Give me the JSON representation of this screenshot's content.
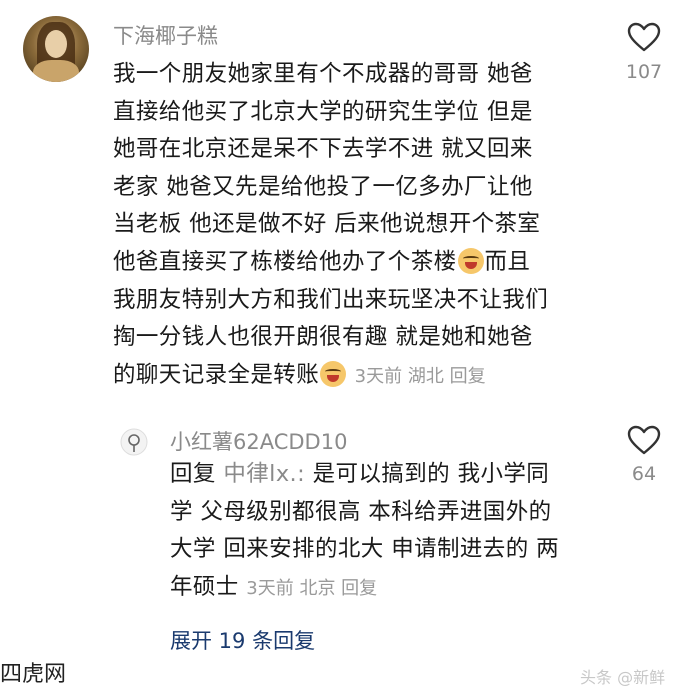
{
  "comment1": {
    "username": "下海椰子糕",
    "lines": [
      "我一个朋友她家里有个不成器的哥哥 她爸",
      "直接给他买了北京大学的研究生学位 但是",
      "她哥在北京还是呆不下去学不进 就又回来",
      "老家 她爸又先是给他投了一亿多办厂让他",
      "当老板 他还是做不好 后来他说想开个茶室",
      "他爸直接买了栋楼给他办了个茶楼",
      "而且",
      "我朋友特别大方和我们出来玩坚决不让我们",
      "掏一分钱人也很开朗很有趣 就是她和她爸",
      "的聊天记录全是转账"
    ],
    "meta": "3天前 湖北 回复",
    "likes": "107",
    "emoji_icon": "crying-face-icon"
  },
  "comment2": {
    "username": "小红薯62ACDD10",
    "reply_prefix": "回复",
    "mention": "中律lx.:",
    "lines": [
      "是可以搞到的 我小学同",
      "学 父母级别都很高 本科给弄进国外的",
      "大学 回来安排的北大 申请制进去的 两",
      "年硕士"
    ],
    "meta": "3天前 北京 回复",
    "likes": "64"
  },
  "expand_replies": "展开 19 条回复",
  "watermark_left": "四虎网",
  "watermark_right": "头条 @新鲜"
}
